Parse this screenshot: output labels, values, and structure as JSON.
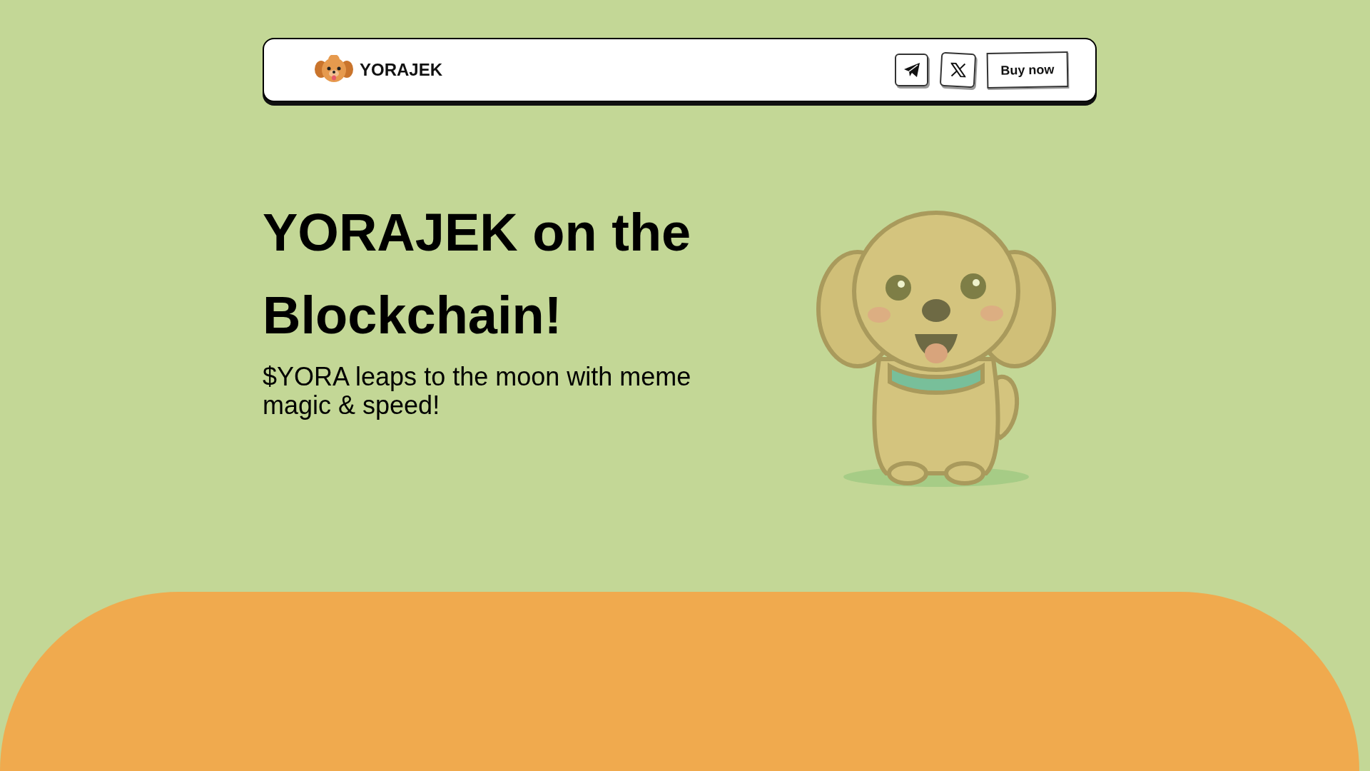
{
  "header": {
    "brand": "YORAJEK",
    "buy_button": "Buy now"
  },
  "hero": {
    "title": "YORAJEK on the Blockchain!",
    "subtitle": "$YORA leaps to the moon with meme magic & speed!"
  }
}
